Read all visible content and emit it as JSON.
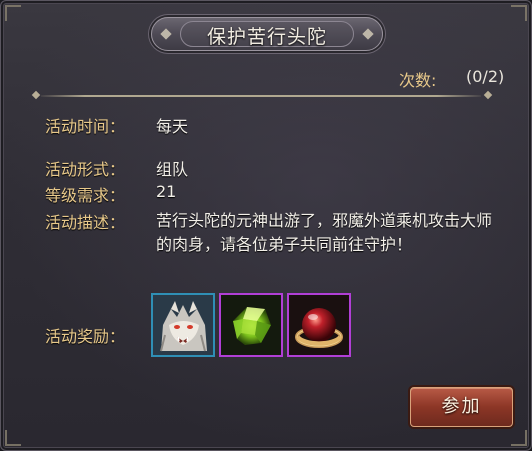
{
  "dialog": {
    "title": "保护苦行头陀",
    "count_label": "次数:",
    "count_value": "(0/2)"
  },
  "rows": {
    "time_label": "活动时间：",
    "time_value": "每天",
    "form_label": "活动形式：",
    "form_value": "组队",
    "level_label": "等级需求：",
    "level_value": "21",
    "desc_label": "活动描述：",
    "desc_value": "苦行头陀的元神出游了，邪魔外道乘机攻击大师的肉身，请各位弟子共同前往守护！",
    "reward_label": "活动奖励："
  },
  "rewards": [
    {
      "icon": "white-wolf-beast-icon",
      "quality_color": "#2f8fb5"
    },
    {
      "icon": "green-gem-icon",
      "quality_color": "#b13fd6"
    },
    {
      "icon": "red-orb-ring-icon",
      "quality_color": "#b13fd6"
    }
  ],
  "buttons": {
    "join_label": "参加"
  },
  "colors": {
    "label_gold": "#e8c98a",
    "value_white": "#f2efe8",
    "button_red": "#8c3626"
  }
}
